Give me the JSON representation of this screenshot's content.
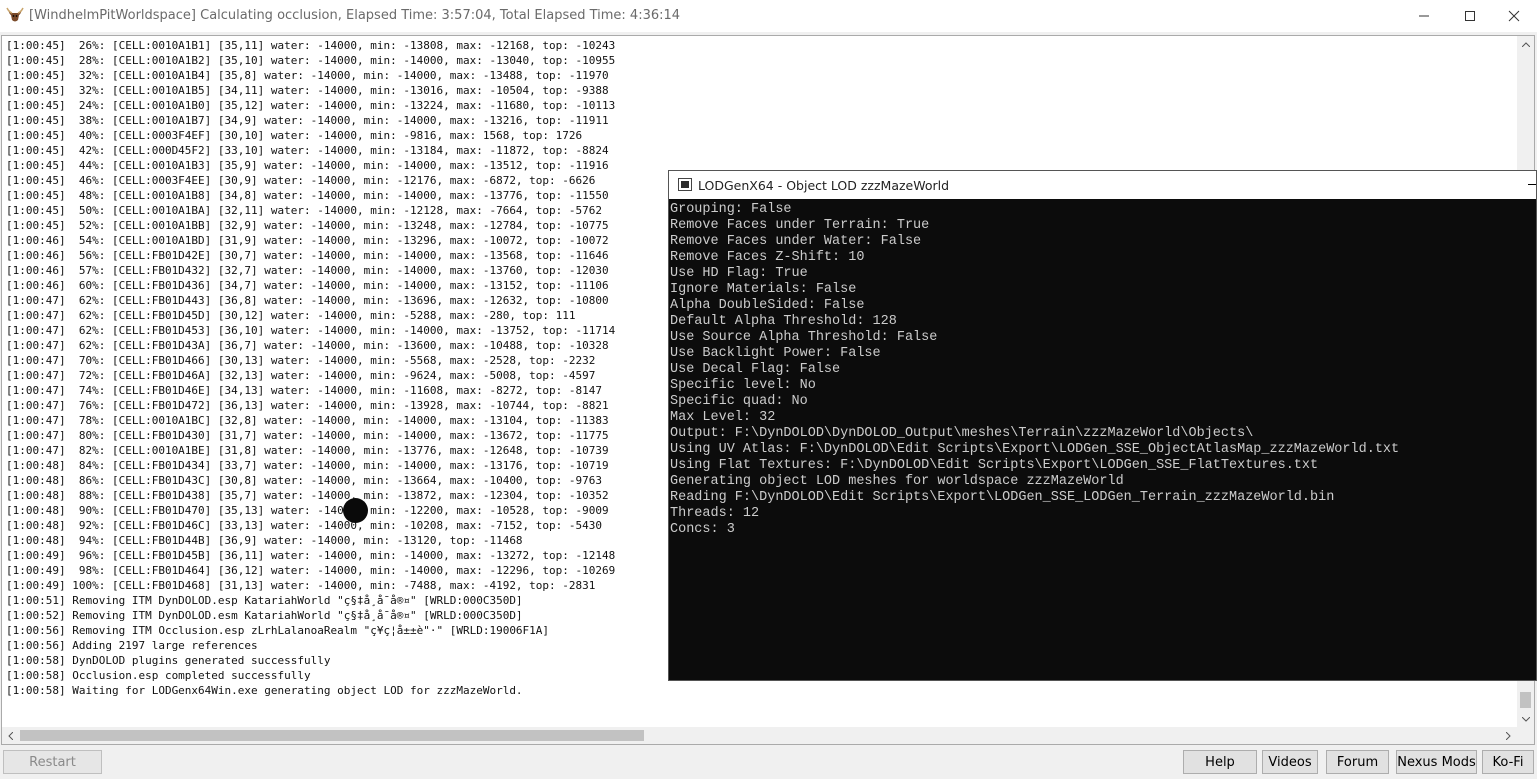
{
  "window": {
    "title": "[WindhelmPitWorldspace] Calculating occlusion, Elapsed Time: 3:57:04, Total Elapsed Time: 4:36:14",
    "icon": "ox-head-icon"
  },
  "log": {
    "lines": [
      "[1:00:45]  26%: [CELL:0010A1B1] [35,11] water: -14000, min: -13808, max: -12168, top: -10243",
      "[1:00:45]  28%: [CELL:0010A1B2] [35,10] water: -14000, min: -14000, max: -13040, top: -10955",
      "[1:00:45]  32%: [CELL:0010A1B4] [35,8] water: -14000, min: -14000, max: -13488, top: -11970",
      "[1:00:45]  32%: [CELL:0010A1B5] [34,11] water: -14000, min: -13016, max: -10504, top: -9388",
      "[1:00:45]  24%: [CELL:0010A1B0] [35,12] water: -14000, min: -13224, max: -11680, top: -10113",
      "[1:00:45]  38%: [CELL:0010A1B7] [34,9] water: -14000, min: -14000, max: -13216, top: -11911",
      "[1:00:45]  40%: [CELL:0003F4EF] [30,10] water: -14000, min: -9816, max: 1568, top: 1726",
      "[1:00:45]  42%: [CELL:000D45F2] [33,10] water: -14000, min: -13184, max: -11872, top: -8824",
      "[1:00:45]  44%: [CELL:0010A1B3] [35,9] water: -14000, min: -14000, max: -13512, top: -11916",
      "[1:00:45]  46%: [CELL:0003F4EE] [30,9] water: -14000, min: -12176, max: -6872, top: -6626",
      "[1:00:45]  48%: [CELL:0010A1B8] [34,8] water: -14000, min: -14000, max: -13776, top: -11550",
      "[1:00:45]  50%: [CELL:0010A1BA] [32,11] water: -14000, min: -12128, max: -7664, top: -5762",
      "[1:00:45]  52%: [CELL:0010A1BB] [32,9] water: -14000, min: -13248, max: -12784, top: -10775",
      "[1:00:46]  54%: [CELL:0010A1BD] [31,9] water: -14000, min: -13296, max: -10072, top: -10072",
      "[1:00:46]  56%: [CELL:FB01D42E] [30,7] water: -14000, min: -14000, max: -13568, top: -11646",
      "[1:00:46]  57%: [CELL:FB01D432] [32,7] water: -14000, min: -14000, max: -13760, top: -12030",
      "[1:00:46]  60%: [CELL:FB01D436] [34,7] water: -14000, min: -14000, max: -13152, top: -11106",
      "[1:00:47]  62%: [CELL:FB01D443] [36,8] water: -14000, min: -13696, max: -12632, top: -10800",
      "[1:00:47]  62%: [CELL:FB01D45D] [30,12] water: -14000, min: -5288, max: -280, top: 111",
      "[1:00:47]  62%: [CELL:FB01D453] [36,10] water: -14000, min: -14000, max: -13752, top: -11714",
      "[1:00:47]  62%: [CELL:FB01D43A] [36,7] water: -14000, min: -13600, max: -10488, top: -10328",
      "[1:00:47]  70%: [CELL:FB01D466] [30,13] water: -14000, min: -5568, max: -2528, top: -2232",
      "[1:00:47]  72%: [CELL:FB01D46A] [32,13] water: -14000, min: -9624, max: -5008, top: -4597",
      "[1:00:47]  74%: [CELL:FB01D46E] [34,13] water: -14000, min: -11608, max: -8272, top: -8147",
      "[1:00:47]  76%: [CELL:FB01D472] [36,13] water: -14000, min: -13928, max: -10744, top: -8821",
      "[1:00:47]  78%: [CELL:0010A1BC] [32,8] water: -14000, min: -14000, max: -13104, top: -11383",
      "[1:00:47]  80%: [CELL:FB01D430] [31,7] water: -14000, min: -14000, max: -13672, top: -11775",
      "[1:00:47]  82%: [CELL:0010A1BE] [31,8] water: -14000, min: -13776, max: -12648, top: -10739",
      "[1:00:48]  84%: [CELL:FB01D434] [33,7] water: -14000, min: -14000, max: -13176, top: -10719",
      "[1:00:48]  86%: [CELL:FB01D43C] [30,8] water: -14000, min: -13664, max: -10400, top: -9763",
      "[1:00:48]  88%: [CELL:FB01D438] [35,7] water: -14000, min: -13872, max: -12304, top: -10352",
      "[1:00:48]  90%: [CELL:FB01D470] [35,13] water: -14000, min: -12200, max: -10528, top: -9009",
      "[1:00:48]  92%: [CELL:FB01D46C] [33,13] water: -14000, min: -10208, max: -7152, top: -5430",
      "[1:00:48]  94%: [CELL:FB01D44B] [36,9] water: -14000, min: -13120, top: -11468",
      "[1:00:49]  96%: [CELL:FB01D45B] [36,11] water: -14000, min: -14000, max: -13272, top: -12148",
      "[1:00:49]  98%: [CELL:FB01D464] [36,12] water: -14000, min: -14000, max: -12296, top: -10269",
      "[1:00:49] 100%: [CELL:FB01D468] [31,13] water: -14000, min: -7488, max: -4192, top: -2831",
      "[1:00:51] Removing ITM DynDOLOD.esp KatariahWorld \"ç§‡å¸å¯å®¤\" [WRLD:000C350D]",
      "[1:00:52] Removing ITM DynDOLOD.esm KatariahWorld \"ç§‡å¸å¯å®¤\" [WRLD:000C350D]",
      "[1:00:56] Removing ITM Occlusion.esp zLrhLalanoaRealm \"ç¥ç¦å±±è\"·\" [WRLD:19006F1A]",
      "[1:00:56] Adding 2197 large references",
      "[1:00:58] DynDOLOD plugins generated successfully",
      "[1:00:58] Occlusion.esp completed successfully",
      "[1:00:58] Waiting for LODGenx64Win.exe generating object LOD for zzzMazeWorld."
    ]
  },
  "console": {
    "title": "LODGenX64 - Object LOD zzzMazeWorld",
    "lines": [
      "Grouping: False",
      "Remove Faces under Terrain: True",
      "Remove Faces under Water: False",
      "Remove Faces Z-Shift: 10",
      "Use HD Flag: True",
      "Ignore Materials: False",
      "Alpha DoubleSided: False",
      "Default Alpha Threshold: 128",
      "Use Source Alpha Threshold: False",
      "Use Backlight Power: False",
      "Use Decal Flag: False",
      "Specific level: No",
      "Specific quad: No",
      "Max Level: 32",
      "Output: F:\\DynDOLOD\\DynDOLOD_Output\\meshes\\Terrain\\zzzMazeWorld\\Objects\\",
      "Using UV Atlas: F:\\DynDOLOD\\Edit Scripts\\Export\\LODGen_SSE_ObjectAtlasMap_zzzMazeWorld.txt",
      "Using Flat Textures: F:\\DynDOLOD\\Edit Scripts\\Export\\LODGen_SSE_FlatTextures.txt",
      "Generating object LOD meshes for worldspace zzzMazeWorld",
      "Reading F:\\DynDOLOD\\Edit Scripts\\Export\\LODGen_SSE_LODGen_Terrain_zzzMazeWorld.bin",
      "Threads: 12",
      "Concs: 3"
    ]
  },
  "buttons": {
    "restart": "Restart",
    "help": "Help",
    "videos": "Videos",
    "forum": "Forum",
    "nexus_mods": "Nexus Mods",
    "ko_fi": "Ko-Fi"
  }
}
